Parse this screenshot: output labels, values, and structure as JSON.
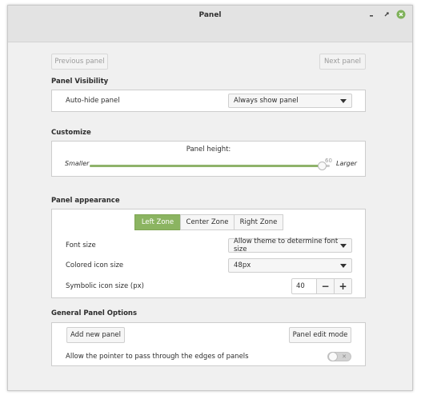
{
  "window": {
    "title": "Panel"
  },
  "nav": {
    "previous_label": "Previous panel",
    "next_label": "Next panel"
  },
  "visibility": {
    "title": "Panel Visibility",
    "autohide_label": "Auto-hide panel",
    "autohide_value": "Always show panel"
  },
  "customize": {
    "title": "Customize",
    "height_label": "Panel height:",
    "smaller_label": "Smaller",
    "larger_label": "Larger",
    "height_value": "60",
    "height_fraction": 0.97
  },
  "appearance": {
    "title": "Panel appearance",
    "zones": [
      {
        "label": "Left Zone",
        "active": true
      },
      {
        "label": "Center Zone",
        "active": false
      },
      {
        "label": "Right Zone",
        "active": false
      }
    ],
    "font_size_label": "Font size",
    "font_size_value": "Allow theme to determine font size",
    "colored_icon_label": "Colored icon size",
    "colored_icon_value": "48px",
    "symbolic_icon_label": "Symbolic icon size (px)",
    "symbolic_icon_value": "40",
    "minus_label": "−",
    "plus_label": "+"
  },
  "general": {
    "title": "General Panel Options",
    "add_panel_label": "Add new panel",
    "edit_mode_label": "Panel edit mode",
    "pointer_pass_label": "Allow the pointer to pass through the edges of panels",
    "pointer_pass_enabled": false
  },
  "colors": {
    "accent": "#8bb461",
    "close_button": "#7fb25a"
  }
}
